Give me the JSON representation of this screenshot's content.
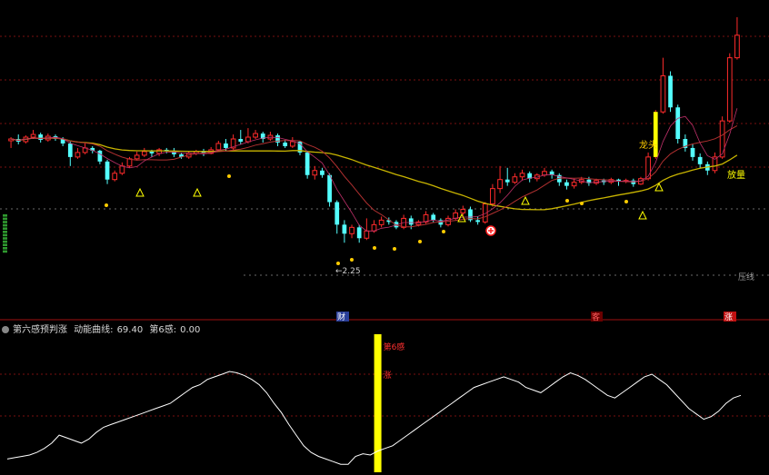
{
  "colors": {
    "up": "#ff2b2b",
    "down": "#54ffff",
    "ma_long": "#c8b400",
    "ma_short": "#b03030",
    "grid": "#7a1010",
    "indicator_line": "#ffffff",
    "signal_bar": "#ffff00",
    "panel_border": "#a01010",
    "label_yellow": "#ffcc00",
    "label_red": "#ff3030"
  },
  "indicator": {
    "name": "第六感预判涨",
    "line_label": "动能曲线:",
    "line_value": "69.40",
    "signal_label": "第6感:",
    "signal_value": "0.00"
  },
  "labels": {
    "low_price": "←2.25",
    "resistance": "压线",
    "release": "放量",
    "left_mark": "龙头",
    "sixth_sense": "第6感",
    "rise_bottom": "涨",
    "rise_bar": "涨",
    "marker_cai": "财",
    "marker_ke": "客"
  },
  "chart_data": {
    "type": "candlestick",
    "candles": [
      [
        3.48,
        3.5,
        3.52,
        3.4
      ],
      [
        3.5,
        3.47,
        3.55,
        3.44
      ],
      [
        3.47,
        3.52,
        3.54,
        3.45
      ],
      [
        3.52,
        3.55,
        3.6,
        3.5
      ],
      [
        3.55,
        3.49,
        3.57,
        3.46
      ],
      [
        3.49,
        3.53,
        3.56,
        3.47
      ],
      [
        3.53,
        3.5,
        3.55,
        3.48
      ],
      [
        3.5,
        3.45,
        3.52,
        3.42
      ],
      [
        3.45,
        3.3,
        3.47,
        3.2
      ],
      [
        3.3,
        3.35,
        3.4,
        3.28
      ],
      [
        3.35,
        3.4,
        3.45,
        3.33
      ],
      [
        3.4,
        3.37,
        3.42,
        3.34
      ],
      [
        3.37,
        3.25,
        3.38,
        3.22
      ],
      [
        3.25,
        3.05,
        3.27,
        3.0
      ],
      [
        3.05,
        3.12,
        3.15,
        3.03
      ],
      [
        3.12,
        3.2,
        3.24,
        3.1
      ],
      [
        3.2,
        3.28,
        3.3,
        3.18
      ],
      [
        3.28,
        3.32,
        3.36,
        3.26
      ],
      [
        3.32,
        3.36,
        3.4,
        3.3
      ],
      [
        3.36,
        3.34,
        3.38,
        3.3
      ],
      [
        3.34,
        3.38,
        3.4,
        3.31
      ],
      [
        3.38,
        3.37,
        3.4,
        3.34
      ],
      [
        3.37,
        3.33,
        3.4,
        3.3
      ],
      [
        3.33,
        3.3,
        3.35,
        3.28
      ],
      [
        3.3,
        3.34,
        3.36,
        3.28
      ],
      [
        3.34,
        3.36,
        3.38,
        3.32
      ],
      [
        3.36,
        3.34,
        3.39,
        3.31
      ],
      [
        3.34,
        3.38,
        3.41,
        3.33
      ],
      [
        3.38,
        3.45,
        3.48,
        3.37
      ],
      [
        3.45,
        3.4,
        3.5,
        3.36
      ],
      [
        3.4,
        3.5,
        3.55,
        3.38
      ],
      [
        3.5,
        3.47,
        3.6,
        3.44
      ],
      [
        3.47,
        3.52,
        3.62,
        3.45
      ],
      [
        3.52,
        3.56,
        3.6,
        3.5
      ],
      [
        3.56,
        3.5,
        3.58,
        3.46
      ],
      [
        3.5,
        3.54,
        3.58,
        3.48
      ],
      [
        3.54,
        3.46,
        3.56,
        3.42
      ],
      [
        3.46,
        3.42,
        3.49,
        3.4
      ],
      [
        3.42,
        3.47,
        3.52,
        3.4
      ],
      [
        3.47,
        3.35,
        3.48,
        3.32
      ],
      [
        3.35,
        3.1,
        3.37,
        3.06
      ],
      [
        3.1,
        3.15,
        3.2,
        3.05
      ],
      [
        3.15,
        3.1,
        3.18,
        3.07
      ],
      [
        3.1,
        2.8,
        3.12,
        2.75
      ],
      [
        2.8,
        2.55,
        2.82,
        2.45
      ],
      [
        2.55,
        2.45,
        2.6,
        2.35
      ],
      [
        2.45,
        2.52,
        2.55,
        2.4
      ],
      [
        2.52,
        2.4,
        2.55,
        2.35
      ],
      [
        2.4,
        2.48,
        2.62,
        2.38
      ],
      [
        2.48,
        2.55,
        2.6,
        2.46
      ],
      [
        2.55,
        2.6,
        2.64,
        2.52
      ],
      [
        2.6,
        2.58,
        2.63,
        2.55
      ],
      [
        2.58,
        2.52,
        2.6,
        2.5
      ],
      [
        2.52,
        2.62,
        2.66,
        2.5
      ],
      [
        2.62,
        2.55,
        2.65,
        2.5
      ],
      [
        2.55,
        2.58,
        2.6,
        2.53
      ],
      [
        2.58,
        2.66,
        2.7,
        2.56
      ],
      [
        2.66,
        2.6,
        2.68,
        2.57
      ],
      [
        2.6,
        2.55,
        2.62,
        2.52
      ],
      [
        2.55,
        2.62,
        2.65,
        2.53
      ],
      [
        2.62,
        2.68,
        2.72,
        2.6
      ],
      [
        2.68,
        2.72,
        2.76,
        2.65
      ],
      [
        2.72,
        2.6,
        2.75,
        2.58
      ],
      [
        2.6,
        2.58,
        2.64,
        2.55
      ],
      [
        2.58,
        2.78,
        2.8,
        2.56
      ],
      [
        2.78,
        2.95,
        3.0,
        2.75
      ],
      [
        2.95,
        3.05,
        3.2,
        2.9
      ],
      [
        3.05,
        3.02,
        3.18,
        2.98
      ],
      [
        3.02,
        3.08,
        3.12,
        3.0
      ],
      [
        3.08,
        3.12,
        3.16,
        3.04
      ],
      [
        3.12,
        3.06,
        3.14,
        3.02
      ],
      [
        3.06,
        3.1,
        3.12,
        3.03
      ],
      [
        3.1,
        3.14,
        3.18,
        3.08
      ],
      [
        3.14,
        3.1,
        3.16,
        3.06
      ],
      [
        3.1,
        3.02,
        3.12,
        2.98
      ],
      [
        3.02,
        2.98,
        3.05,
        2.94
      ],
      [
        2.98,
        3.02,
        3.06,
        2.95
      ],
      [
        3.02,
        3.05,
        3.08,
        3.0
      ],
      [
        3.05,
        3.01,
        3.08,
        2.98
      ],
      [
        3.01,
        3.04,
        3.06,
        2.99
      ],
      [
        3.04,
        3.02,
        3.06,
        2.99
      ],
      [
        3.02,
        3.05,
        3.07,
        3.0
      ],
      [
        3.05,
        3.03,
        3.06,
        2.98
      ],
      [
        3.03,
        3.04,
        3.06,
        3.01
      ],
      [
        3.04,
        3.0,
        3.06,
        2.97
      ],
      [
        3.0,
        3.06,
        3.08,
        2.99
      ],
      [
        3.06,
        3.3,
        3.35,
        3.04
      ],
      [
        3.3,
        3.8,
        3.82,
        3.28
      ],
      [
        3.8,
        4.2,
        4.4,
        3.78
      ],
      [
        4.2,
        3.85,
        4.25,
        3.8
      ],
      [
        3.85,
        3.5,
        3.88,
        3.45
      ],
      [
        3.5,
        3.4,
        3.55,
        3.36
      ],
      [
        3.4,
        3.3,
        3.45,
        3.26
      ],
      [
        3.3,
        3.22,
        3.34,
        3.18
      ],
      [
        3.22,
        3.15,
        3.25,
        3.1
      ],
      [
        3.15,
        3.3,
        3.35,
        3.12
      ],
      [
        3.3,
        3.7,
        3.75,
        3.28
      ],
      [
        3.7,
        4.4,
        4.45,
        3.68
      ],
      [
        4.4,
        4.65,
        4.85,
        4.38
      ]
    ],
    "ylim": [
      2.0,
      5.0
    ],
    "annotations": [
      "←2.25",
      "压线",
      "放量",
      "龙头"
    ]
  },
  "indicator_data": {
    "type": "line",
    "values": [
      10,
      11,
      12,
      13,
      15,
      18,
      22,
      28,
      26,
      24,
      22,
      25,
      30,
      34,
      36,
      38,
      40,
      42,
      44,
      46,
      48,
      50,
      52,
      56,
      60,
      64,
      66,
      70,
      72,
      74,
      76,
      75,
      73,
      70,
      66,
      60,
      52,
      45,
      36,
      28,
      20,
      15,
      12,
      10,
      8,
      6,
      6,
      12,
      14,
      13,
      16,
      18,
      20,
      24,
      28,
      32,
      36,
      40,
      44,
      48,
      52,
      56,
      60,
      64,
      66,
      68,
      70,
      72,
      70,
      68,
      64,
      62,
      60,
      64,
      68,
      72,
      75,
      73,
      70,
      66,
      62,
      58,
      56,
      60,
      64,
      68,
      72,
      74,
      70,
      66,
      60,
      54,
      48,
      44,
      40,
      42,
      46,
      52,
      56,
      58
    ],
    "signal_index": 50,
    "ylim": [
      0,
      100
    ]
  }
}
